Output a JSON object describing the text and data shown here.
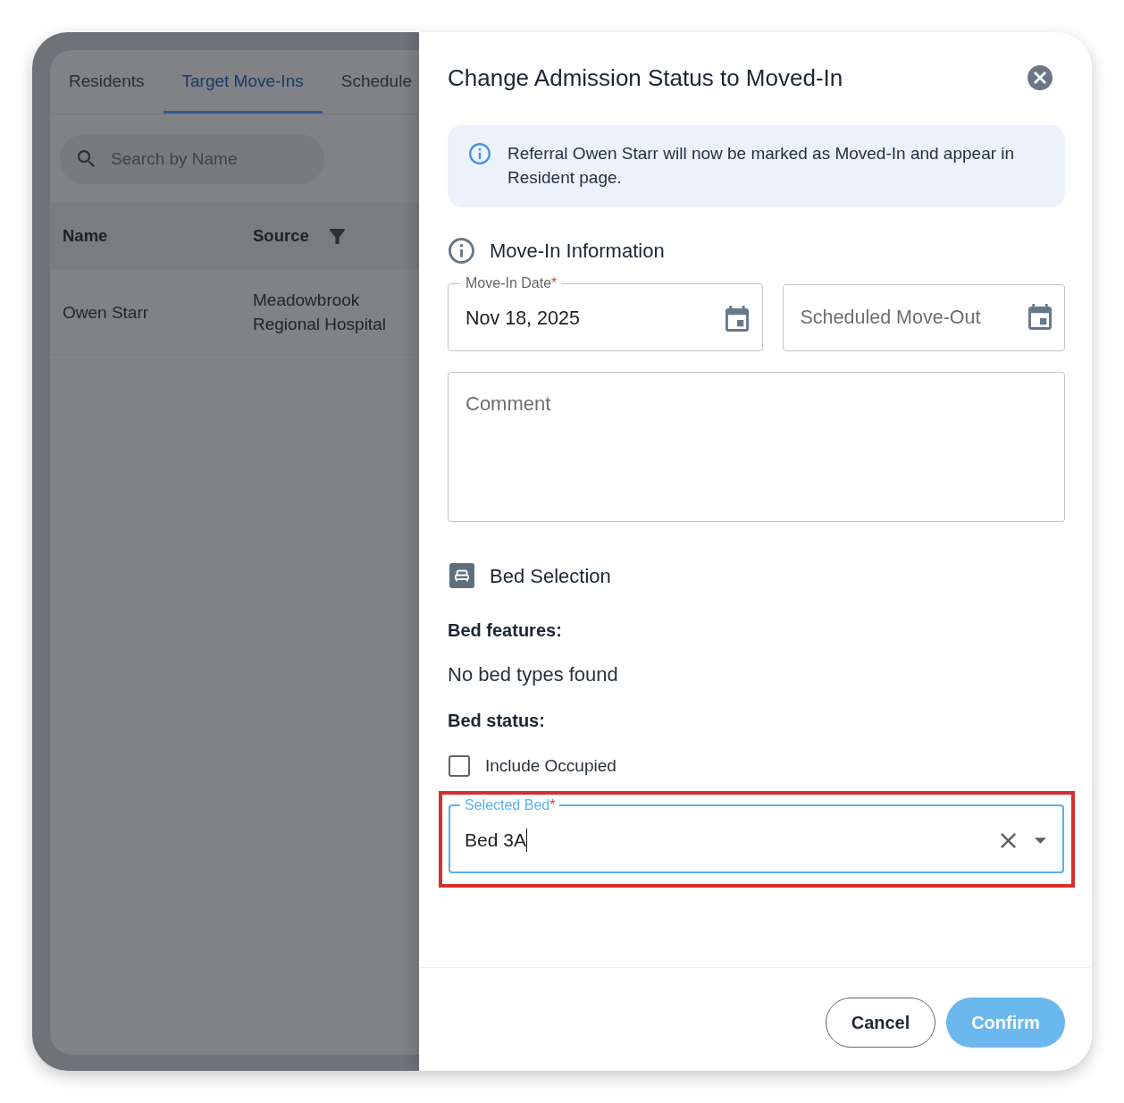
{
  "background_page": {
    "tabs": [
      {
        "label": "Residents",
        "selected": false
      },
      {
        "label": "Target Move-Ins",
        "selected": true
      },
      {
        "label": "Schedule",
        "selected": false
      }
    ],
    "search": {
      "placeholder": "Search by Name"
    },
    "table": {
      "columns": [
        {
          "label": "Name",
          "filter": false
        },
        {
          "label": "Source",
          "filter": true
        }
      ],
      "rows": [
        {
          "cells": [
            "Owen Starr",
            "Meadowbrook Regional Hospital"
          ]
        }
      ]
    }
  },
  "dialog": {
    "title": "Change Admission Status to Moved-In",
    "info_message": "Referral Owen Starr will now be marked as Moved-In and appear in Resident page.",
    "move_in_section": {
      "title": "Move-In Information",
      "move_in_date": {
        "label": "Move-In Date",
        "required_mark": "*",
        "value": "Nov 18, 2025"
      },
      "move_out_date": {
        "placeholder": "Scheduled Move-Out"
      },
      "comment": {
        "placeholder": "Comment"
      }
    },
    "bed_section": {
      "title": "Bed Selection",
      "features_label": "Bed features:",
      "features_value": "No bed types found",
      "status_label": "Bed status:",
      "include_occupied": {
        "label": "Include Occupied",
        "checked": false
      },
      "selected_bed": {
        "label": "Selected Bed",
        "required_mark": "*",
        "value": "Bed 3A",
        "focused": true,
        "highlighted": true
      }
    },
    "buttons": [
      {
        "label": "Cancel",
        "kind": "outlined"
      },
      {
        "label": "Confirm",
        "kind": "primary"
      }
    ]
  }
}
